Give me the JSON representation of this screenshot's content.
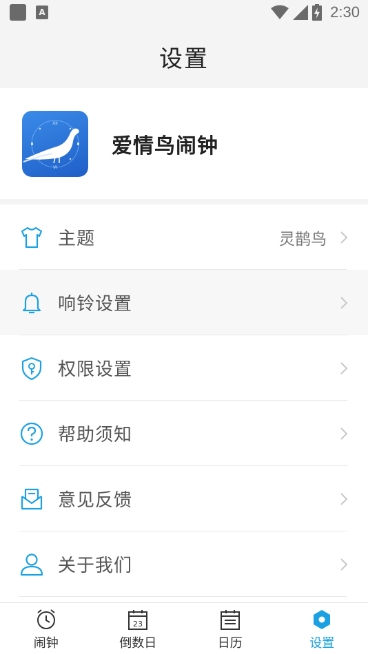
{
  "status_bar": {
    "time": "2:30",
    "a_label": "A"
  },
  "header": {
    "title": "设置"
  },
  "app": {
    "name": "爱情鸟闹钟",
    "logo_numerals": {
      "top": "XII",
      "bottom": "VI"
    }
  },
  "settings": {
    "items": [
      {
        "label": "主题",
        "value": "灵鹊鸟",
        "icon": "shirt-icon"
      },
      {
        "label": "响铃设置",
        "icon": "bell-icon"
      },
      {
        "label": "权限设置",
        "icon": "shield-key-icon"
      },
      {
        "label": "帮助须知",
        "icon": "help-icon"
      },
      {
        "label": "意见反馈",
        "icon": "feedback-mail-icon"
      },
      {
        "label": "关于我们",
        "icon": "user-icon"
      }
    ]
  },
  "tabs": [
    {
      "label": "闹钟",
      "icon": "alarm-clock-icon",
      "active": false
    },
    {
      "label": "倒数日",
      "icon": "calendar-day-icon",
      "day": "23",
      "active": false
    },
    {
      "label": "日历",
      "icon": "calendar-list-icon",
      "active": false
    },
    {
      "label": "设置",
      "icon": "settings-hex-icon",
      "active": true
    }
  ],
  "colors": {
    "accent": "#1ba1e2",
    "text": "#555555",
    "background": "#f4f4f4"
  }
}
